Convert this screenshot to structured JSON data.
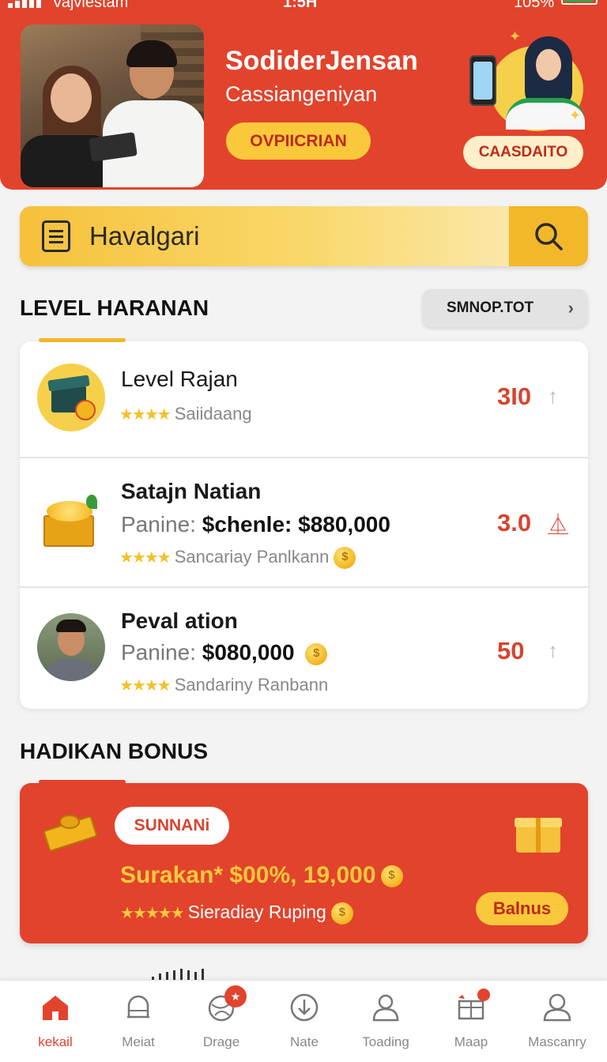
{
  "status_bar": {
    "carrier": "Vajviestam",
    "time": "1:5H",
    "battery": "105%"
  },
  "hero": {
    "title": "SodiderJensan",
    "subtitle": "Cassiangeniyan",
    "primary_button": "OVPIICRIAN",
    "secondary_button": "CAASDAITO"
  },
  "search": {
    "placeholder": "Havalgari"
  },
  "level_section": {
    "title": "LEVEL HARANAN",
    "more_button": "SMNOP.TOT",
    "items": [
      {
        "name": "Level Rajan",
        "price_label": "",
        "price_value": "",
        "rating_text": "Saiidaang",
        "stars": 4,
        "score": "3I0",
        "trend": "↑"
      },
      {
        "name": "Satajn Natian",
        "price_label": "Panine:",
        "price_value": "$chenle: $880,000",
        "rating_text": "Sancariay Panlkann",
        "stars": 4,
        "score": "3.0",
        "trend": "⏅"
      },
      {
        "name": "Peval ation",
        "price_label": "Panine:",
        "price_value": "$080,000",
        "rating_text": "Sandariny Ranbann",
        "stars": 4,
        "score": "50",
        "trend": "↑"
      }
    ]
  },
  "bonus_section": {
    "title": "HADIKAN BONUS",
    "chip": "SUNNANi",
    "amount": "Surakan* $00%, 19,000",
    "subtitle": "Sieradiay Ruping",
    "stars": 5,
    "button": "Balnus"
  },
  "bottom_nav": {
    "items": [
      {
        "label": "kekail",
        "icon": "home-icon",
        "active": true
      },
      {
        "label": "Meiat",
        "icon": "bell-icon",
        "active": false
      },
      {
        "label": "Drage",
        "icon": "globe-icon",
        "active": false
      },
      {
        "label": "Nate",
        "icon": "download-icon",
        "active": false
      },
      {
        "label": "Toading",
        "icon": "user-icon",
        "active": false
      },
      {
        "label": "Maap",
        "icon": "map-icon",
        "active": false
      },
      {
        "label": "Mascanry",
        "icon": "profile-icon",
        "active": false
      }
    ]
  },
  "colors": {
    "primary": "#e2432c",
    "accent": "#f9c93b",
    "background": "#f3f3f3"
  }
}
